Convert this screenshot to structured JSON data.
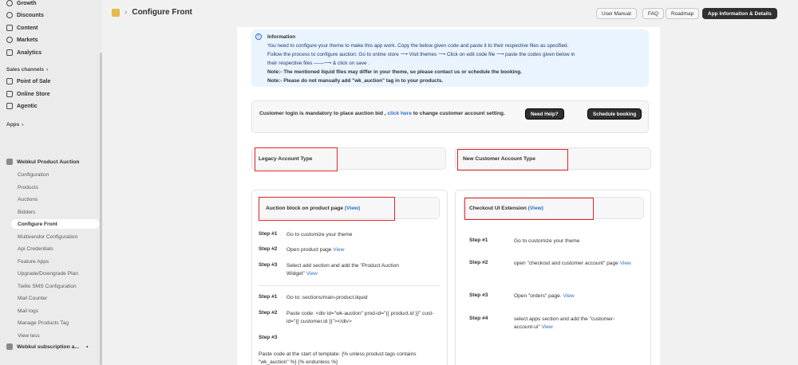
{
  "sidebar": {
    "nav": [
      {
        "label": "Growth",
        "icon": "growth-icon"
      },
      {
        "label": "Discounts",
        "icon": "discount-icon"
      },
      {
        "label": "Content",
        "icon": "content-icon"
      },
      {
        "label": "Markets",
        "icon": "globe-icon"
      },
      {
        "label": "Analytics",
        "icon": "analytics-icon"
      }
    ],
    "sales_channels_label": "Sales channels",
    "channels": [
      {
        "label": "Point of Sale",
        "icon": "pos-icon"
      },
      {
        "label": "Online Store",
        "icon": "store-icon"
      },
      {
        "label": "Agentic",
        "icon": "agentic-icon"
      }
    ],
    "apps_label": "Apps",
    "app_name": "Webkul Product Auction",
    "app_items": [
      "Configuration",
      "Products",
      "Auctions",
      "Bidders",
      "Configure Front",
      "Multivendor Configuration",
      "Api Credentials",
      "Feature Apps",
      "Upgrade/Downgrade Plan",
      "Twilio SMS Configuration",
      "Mail Counter",
      "Mail logs",
      "Manage Products Tag",
      "View less"
    ],
    "second_app": "Webkul subscription a..."
  },
  "header": {
    "title": "Configure Front",
    "buttons": [
      "User Manual",
      "FAQ",
      "Roadmap",
      "App Information & Details"
    ]
  },
  "info": {
    "title": "Information",
    "lines": [
      "You need to configure your theme to make this app work. Copy the below given code and paste it to their respective files as specified.",
      "Follow the process to configure auction: Go to online store ⟶ Visit themes ⟶ Click on edit code file ⟶ paste the codes given below in",
      "their respective files ——⟶ & click on save .",
      "Note:- The mentioned liquid files may differ in your theme, so please contact us or schedule the booking.",
      "Note:- Please do not manually add \"wk_auction\" tag in to your products."
    ]
  },
  "login": {
    "text_before": "Customer login is mandatory to place auction bid , ",
    "link": "click here",
    "text_after": " to change customer account setting.",
    "help_button": "Need Help?",
    "booking_button": "Schedule booking"
  },
  "legacy": {
    "title": "Legacy Account Type"
  },
  "new_account": {
    "title": "New Customer Account Type"
  },
  "auction_block": {
    "title": "Auction block on product page",
    "view": "(View)",
    "steps": [
      {
        "num": "Step #1",
        "text": "Go to customize your theme",
        "link": ""
      },
      {
        "num": "Step #2",
        "text": "Open product page ",
        "link": "View"
      },
      {
        "num": "Step #3",
        "text": "Select add section and add the \"Product Auction Widget\" ",
        "link": "View"
      }
    ],
    "steps2": [
      {
        "num": "Step #1",
        "text": "Go to: sections/main-product.liquid"
      },
      {
        "num": "Step #2",
        "text": "Paste code: <div id=\"wk-auction\" prod-id=\"{{ product.id }}\" cust-id=\"{{ customer.id }}\"></div>"
      },
      {
        "num": "Step #3",
        "text": ""
      }
    ],
    "paste_note": "Paste code at the start of template: {% unless product.tags contains \"wk_auction\" %} {% endunless %}"
  },
  "checkout": {
    "title": "Checkout UI Extension",
    "view": "(View)",
    "steps": [
      {
        "num": "Step #1",
        "text": "Go to customize your theme",
        "link": ""
      },
      {
        "num": "Step #2",
        "text": "open \"checkout and customer account\" page ",
        "link": "View"
      },
      {
        "num": "Step #3",
        "text": "Open \"orders\" page. ",
        "link": "View"
      },
      {
        "num": "Step #4",
        "text": "select apps section and add the \"customer-account-ui\" ",
        "link": "View"
      }
    ]
  },
  "colors": {
    "accent": "#2c6ecb",
    "highlight_border": "#e0262b",
    "dark_button": "#303030",
    "info_bg": "#eaf4ff"
  }
}
